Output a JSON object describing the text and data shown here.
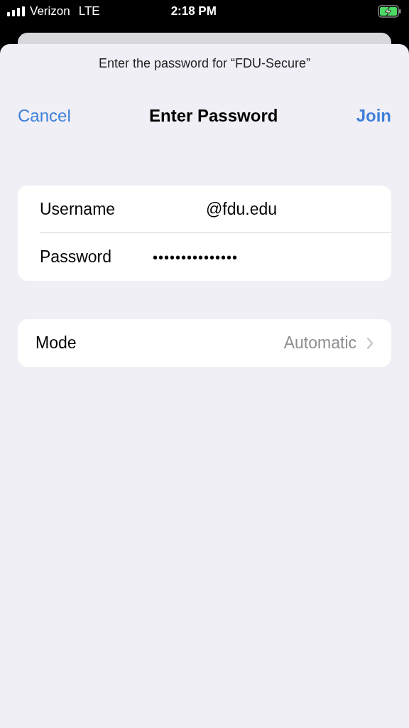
{
  "status_bar": {
    "carrier": "Verizon",
    "network": "LTE",
    "time": "2:18 PM",
    "charging": true
  },
  "sheet": {
    "prompt": "Enter the password for “FDU-Secure”"
  },
  "nav": {
    "cancel": "Cancel",
    "title": "Enter Password",
    "join": "Join"
  },
  "credentials": [
    {
      "label": "Username",
      "value": "@fdu.edu",
      "kind": "text"
    },
    {
      "label": "Password",
      "value": "•••••••••••••••",
      "kind": "secure"
    }
  ],
  "mode": {
    "label": "Mode",
    "value": "Automatic"
  }
}
